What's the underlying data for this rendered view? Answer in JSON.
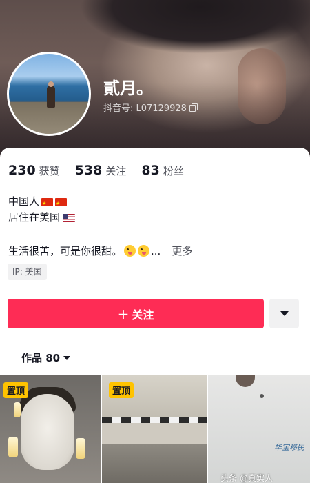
{
  "profile": {
    "name": "貳月。",
    "douyin_id": "抖音号: L07129928"
  },
  "stats": [
    {
      "value": "230",
      "label": "获赞"
    },
    {
      "value": "538",
      "label": "关注"
    },
    {
      "value": "83",
      "label": "粉丝"
    }
  ],
  "bio": {
    "line1": "中国人",
    "line2": "居住在美国",
    "line3": "生活很苦，可是你很甜。",
    "ellipsis": "...",
    "more": "更多"
  },
  "ip": "IP: 美国",
  "actions": {
    "follow": "关注",
    "plus": "+"
  },
  "tab": {
    "works": "作品 80"
  },
  "grid": [
    {
      "badge": "置顶"
    },
    {
      "badge": "置顶"
    },
    {
      "badge": ""
    }
  ],
  "watermarks": {
    "right": "华宝移民",
    "bottom": "头条 @真实人"
  },
  "colors": {
    "accent": "#fe2c55",
    "pin": "#ffc300"
  }
}
